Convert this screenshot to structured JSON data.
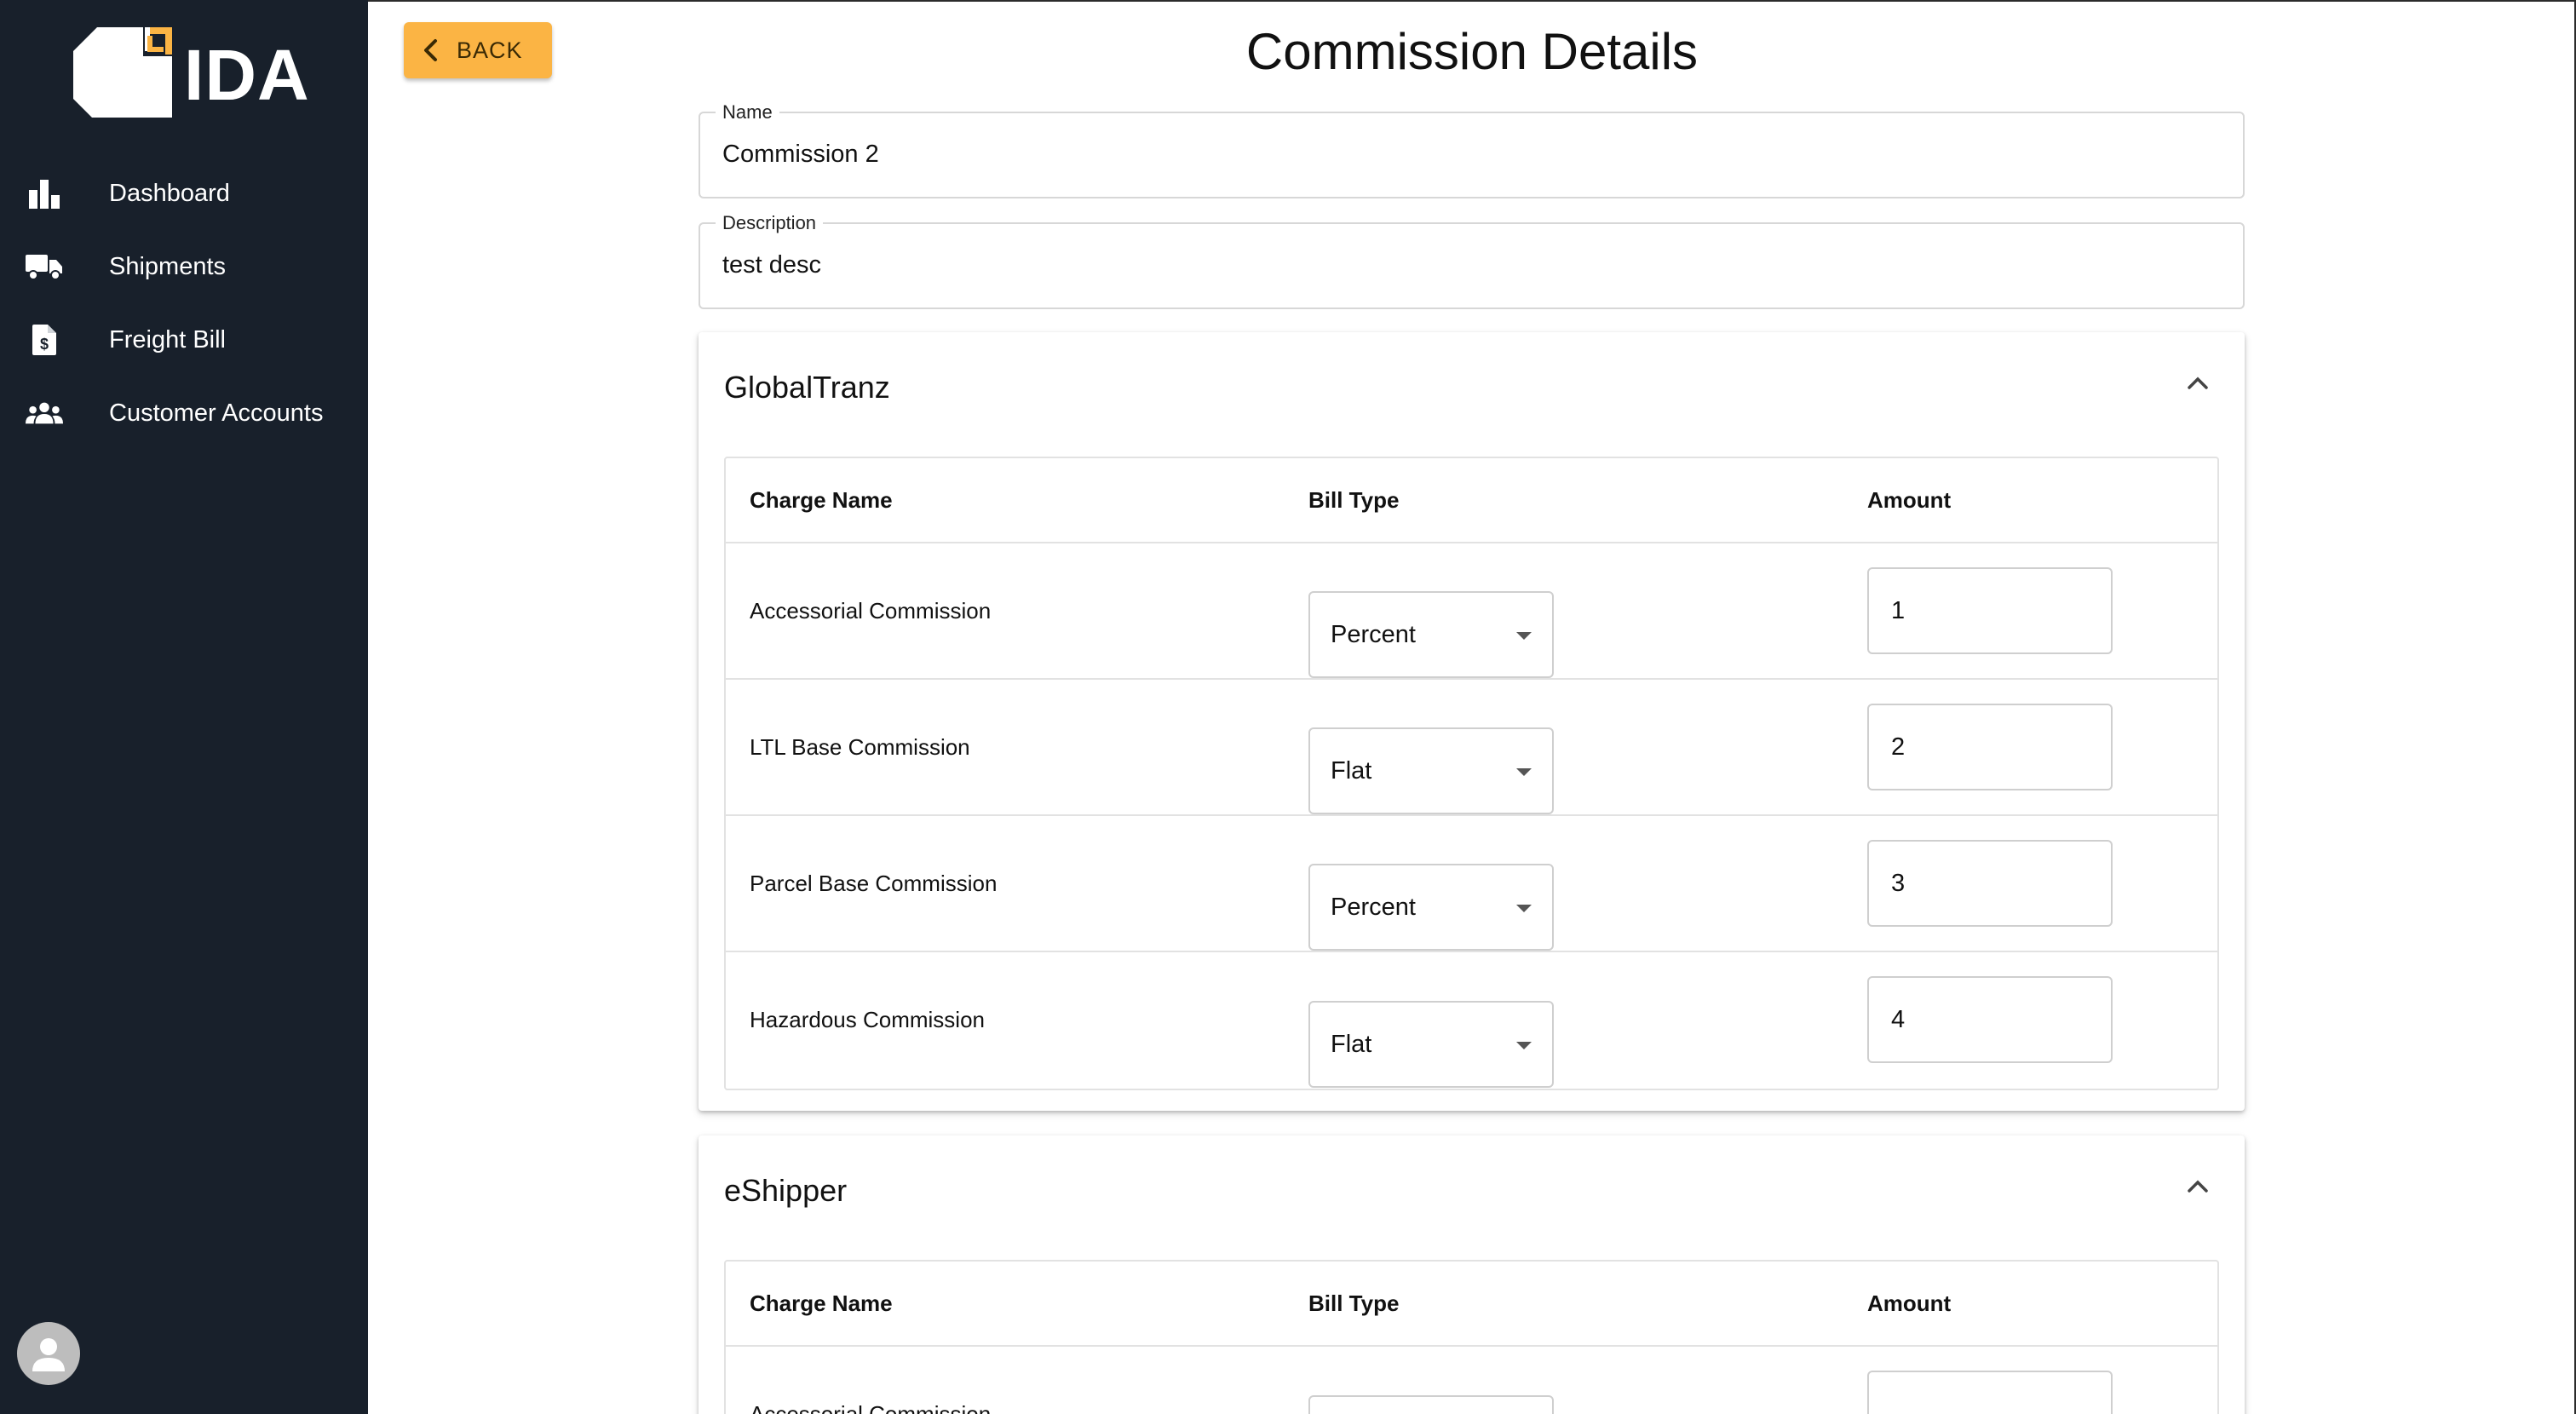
{
  "app": {
    "logo_text": "IDA",
    "accent_color": "#fbb444",
    "sidebar_color": "#18202b"
  },
  "sidebar": {
    "items": [
      {
        "label": "Dashboard",
        "icon": "bar-chart-icon"
      },
      {
        "label": "Shipments",
        "icon": "truck-icon"
      },
      {
        "label": "Freight Bill",
        "icon": "invoice-dollar-icon"
      },
      {
        "label": "Customer Accounts",
        "icon": "group-icon"
      }
    ],
    "avatar_icon": "user-avatar-icon"
  },
  "header": {
    "back_label": "BACK",
    "title": "Commission Details"
  },
  "form": {
    "name_label": "Name",
    "name_value": "Commission 2",
    "description_label": "Description",
    "description_value": "test desc"
  },
  "providers": [
    {
      "title": "GlobalTranz",
      "columns": [
        "Charge Name",
        "Bill Type",
        "Amount"
      ],
      "rows": [
        {
          "charge": "Accessorial Commission",
          "bill_type": "Percent",
          "amount": "1"
        },
        {
          "charge": "LTL Base Commission",
          "bill_type": "Flat",
          "amount": "2"
        },
        {
          "charge": "Parcel Base Commission",
          "bill_type": "Percent",
          "amount": "3"
        },
        {
          "charge": "Hazardous Commission",
          "bill_type": "Flat",
          "amount": "4"
        }
      ]
    },
    {
      "title": "eShipper",
      "columns": [
        "Charge Name",
        "Bill Type",
        "Amount"
      ],
      "rows": [
        {
          "charge": "Accessorial Commission",
          "bill_type": "",
          "amount": ""
        }
      ]
    }
  ]
}
